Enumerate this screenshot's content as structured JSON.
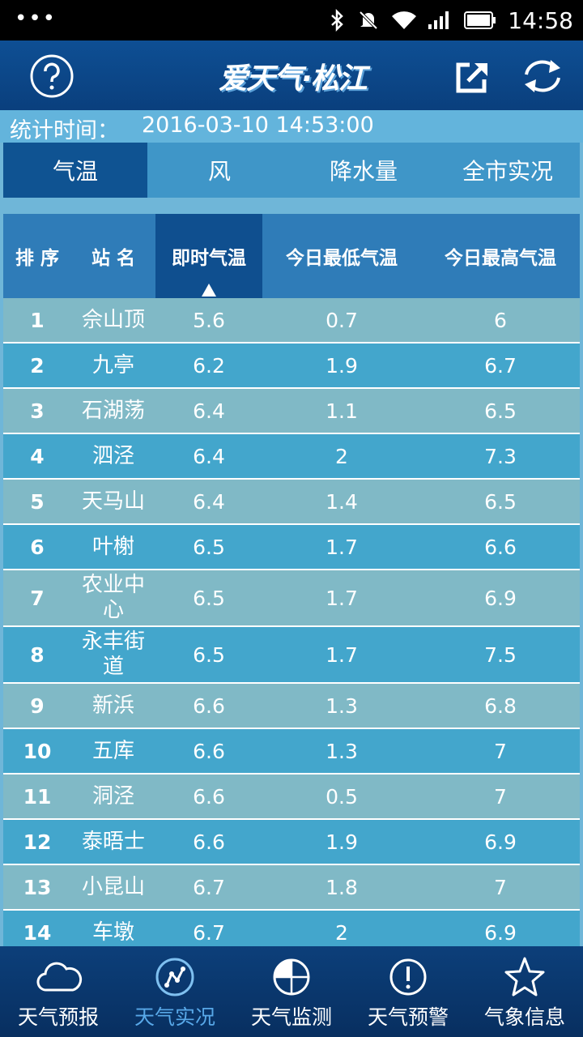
{
  "status_bar": {
    "time": "14:58"
  },
  "header": {
    "logo_text": "爱天气·松江"
  },
  "stat": {
    "label": "统计时间：",
    "value": "2016-03-10 14:53:00"
  },
  "tabs": [
    {
      "label": "气温",
      "active": true
    },
    {
      "label": "风",
      "active": false
    },
    {
      "label": "降水量",
      "active": false
    },
    {
      "label": "全市实况",
      "active": false
    }
  ],
  "table": {
    "headers": [
      "排 序",
      "站 名",
      "即时气温",
      "今日最低气温",
      "今日最高气温"
    ],
    "sorted_column": 2,
    "rows": [
      [
        "1",
        "佘山顶",
        "5.6",
        "0.7",
        "6"
      ],
      [
        "2",
        "九亭",
        "6.2",
        "1.9",
        "6.7"
      ],
      [
        "3",
        "石湖荡",
        "6.4",
        "1.1",
        "6.5"
      ],
      [
        "4",
        "泗泾",
        "6.4",
        "2",
        "7.3"
      ],
      [
        "5",
        "天马山",
        "6.4",
        "1.4",
        "6.5"
      ],
      [
        "6",
        "叶榭",
        "6.5",
        "1.7",
        "6.6"
      ],
      [
        "7",
        "农业中心",
        "6.5",
        "1.7",
        "6.9"
      ],
      [
        "8",
        "永丰街道",
        "6.5",
        "1.7",
        "7.5"
      ],
      [
        "9",
        "新浜",
        "6.6",
        "1.3",
        "6.8"
      ],
      [
        "10",
        "五库",
        "6.6",
        "1.3",
        "7"
      ],
      [
        "11",
        "洞泾",
        "6.6",
        "0.5",
        "7"
      ],
      [
        "12",
        "泰晤士",
        "6.6",
        "1.9",
        "6.9"
      ],
      [
        "13",
        "小昆山",
        "6.7",
        "1.8",
        "7"
      ],
      [
        "14",
        "车墩",
        "6.7",
        "2",
        "6.9"
      ]
    ]
  },
  "bottom_nav": [
    {
      "label": "天气预报",
      "icon": "cloud-icon",
      "active": false
    },
    {
      "label": "天气实况",
      "icon": "live-chart-icon",
      "active": true
    },
    {
      "label": "天气监测",
      "icon": "radar-icon",
      "active": false
    },
    {
      "label": "天气预警",
      "icon": "warning-icon",
      "active": false
    },
    {
      "label": "气象信息",
      "icon": "star-icon",
      "active": false
    }
  ],
  "colors": {
    "header": "#0e4f94",
    "active_tab": "#0f5392",
    "row_light": "#80b9c6",
    "row_dark": "#43a6cc",
    "nav_active": "#58a8e8"
  }
}
